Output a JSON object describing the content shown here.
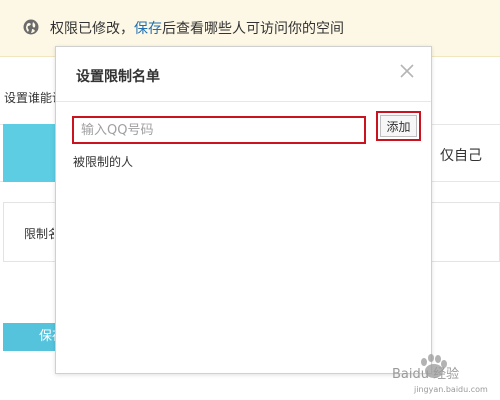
{
  "notice": {
    "text_before": "权限已修改，",
    "link": "保存",
    "text_after": "后查看哪些人可访问你的空间"
  },
  "background": {
    "settings_label": "设置谁能访问",
    "option_right": "仅自己",
    "box_label": "限制名单",
    "save_button": "保存"
  },
  "modal": {
    "title": "设置限制名单",
    "input_placeholder": "输入QQ号码",
    "add_button": "添加",
    "restricted_label": "被限制的人"
  },
  "watermark": {
    "text": "Baidu 经验",
    "url": "jingyan.baidu.com"
  },
  "colors": {
    "highlight_border": "#c9141f",
    "accent": "#5ccde3",
    "notice_bg": "#fdf8e6",
    "link": "#1f6fb2"
  }
}
